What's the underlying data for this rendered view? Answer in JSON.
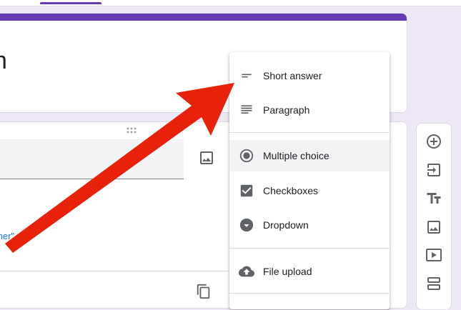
{
  "header": {
    "title_fragment": "n"
  },
  "question": {
    "option_link_fragment": "ther\""
  },
  "menu": {
    "items": [
      {
        "label": "Short answer",
        "icon": "short-answer-icon"
      },
      {
        "label": "Paragraph",
        "icon": "paragraph-icon"
      },
      {
        "label": "Multiple choice",
        "icon": "radio-button-icon",
        "selected": true
      },
      {
        "label": "Checkboxes",
        "icon": "checkbox-icon"
      },
      {
        "label": "Dropdown",
        "icon": "dropdown-circle-icon"
      },
      {
        "label": "File upload",
        "icon": "cloud-upload-icon"
      }
    ]
  },
  "toolbar": {
    "tools": [
      "add-question-icon",
      "import-questions-icon",
      "add-title-icon",
      "add-image-icon",
      "add-video-icon",
      "add-section-icon"
    ]
  },
  "colors": {
    "accent": "#673ab7",
    "background": "#ede7f6",
    "arrow": "#e8220a",
    "link": "#1a73e8"
  }
}
